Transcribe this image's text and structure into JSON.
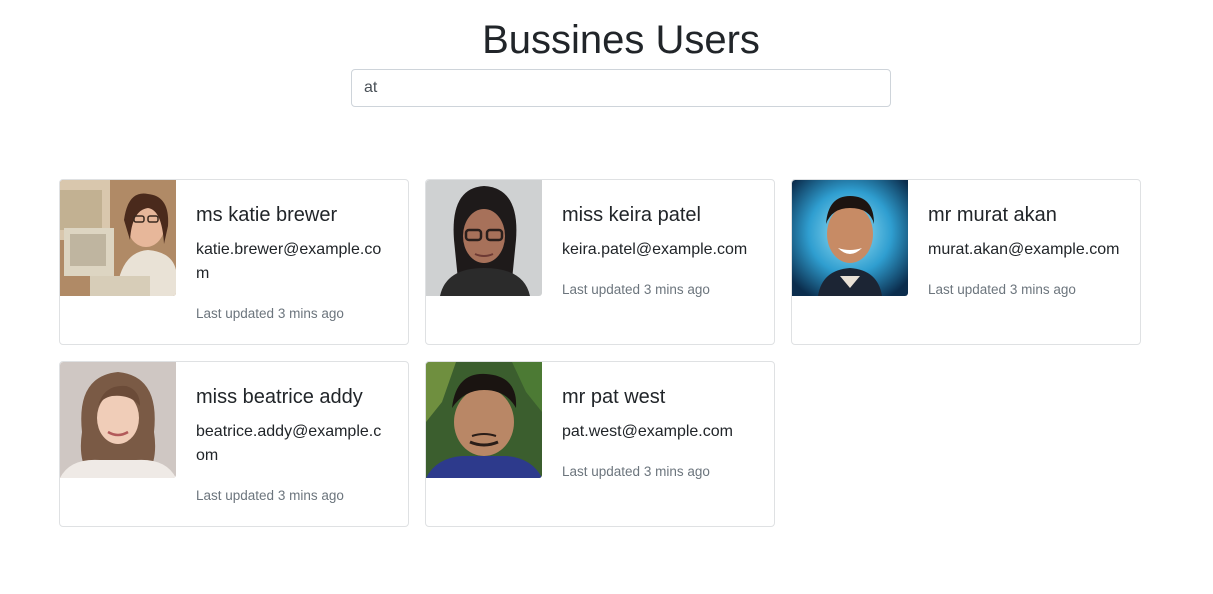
{
  "header": {
    "title": "Bussines Users"
  },
  "search": {
    "value": "at"
  },
  "users": [
    {
      "name": "ms katie brewer",
      "email": "katie.brewer@example.com",
      "updated": "Last updated 3 mins ago",
      "avatar": "woman-at-computer-photo"
    },
    {
      "name": "miss keira patel",
      "email": "keira.patel@example.com",
      "updated": "Last updated 3 mins ago",
      "avatar": "woman-with-glasses-photo"
    },
    {
      "name": "mr murat akan",
      "email": "murat.akan@example.com",
      "updated": "Last updated 3 mins ago",
      "avatar": "smiling-man-photo"
    },
    {
      "name": "miss beatrice addy",
      "email": "beatrice.addy@example.com",
      "updated": "Last updated 3 mins ago",
      "avatar": "smiling-woman-photo"
    },
    {
      "name": "mr pat west",
      "email": "pat.west@example.com",
      "updated": "Last updated 3 mins ago",
      "avatar": "man-selfie-photo"
    }
  ]
}
